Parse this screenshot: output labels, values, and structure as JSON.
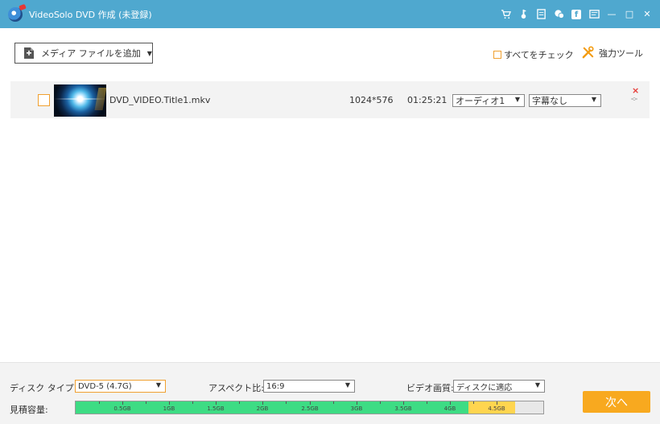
{
  "window": {
    "title": "VideoSolo DVD 作成 (未登録)",
    "controls": [
      "cart-icon",
      "key-icon",
      "document-icon",
      "feedback-icon",
      "facebook-icon",
      "menu-icon",
      "minimize-icon",
      "maximize-icon",
      "close-icon"
    ],
    "facebook_glyph": "f",
    "minimize_glyph": "—",
    "maximize_glyph": "□",
    "close_glyph": "✕"
  },
  "toolbar": {
    "add_media_label": "メディア ファイルを追加",
    "add_media_caret": "▼",
    "check_all_label": "すべてをチェック",
    "power_tools_label": "強力ツール"
  },
  "files": [
    {
      "name": "DVD_VIDEO.Title1.mkv",
      "resolution": "1024*576",
      "duration": "01:25:21",
      "audio": "オーディオ1",
      "subtitle": "字幕なし",
      "checked": false
    }
  ],
  "dropdown_arrow": "▼",
  "row_controls": {
    "remove": "×",
    "up": "︿",
    "down": "﹀"
  },
  "bottom": {
    "disc_type_label": "ディスク タイプ",
    "disc_type_value": "DVD-5 (4.7G)",
    "aspect_label": "アスペクト比:",
    "aspect_value": "16:9",
    "quality_label": "ビデオ画質:",
    "quality_value": "ディスクに適応",
    "capacity_label": "見積容量:",
    "capacity_ticks": [
      "0.5GB",
      "1GB",
      "1.5GB",
      "2GB",
      "2.5GB",
      "3GB",
      "3.5GB",
      "4GB",
      "4.5GB"
    ],
    "capacity_fill_gb": 4.2,
    "capacity_limit_gb": 4.7,
    "capacity_max_gb": 5.0,
    "next_label": "次へ"
  },
  "colors": {
    "titlebar": "#4fa8cf",
    "accent": "#f8a91f",
    "capacity_green": "#3ddc84",
    "capacity_yellow": "#ffd54f"
  }
}
